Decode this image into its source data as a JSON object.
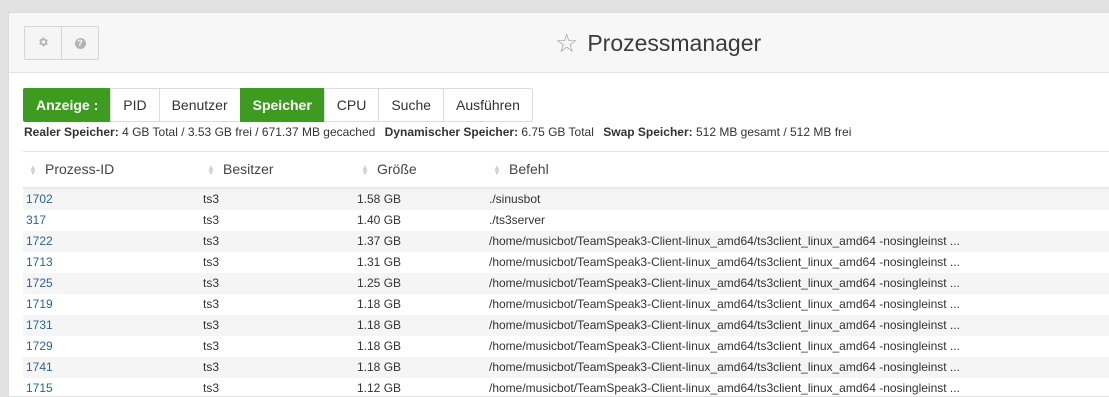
{
  "header": {
    "title": "Prozessmanager",
    "icons": [
      "gear-icon",
      "help-icon"
    ],
    "help_glyph": "?"
  },
  "tabs": [
    {
      "label": "Anzeige :",
      "active": true
    },
    {
      "label": "PID",
      "active": false
    },
    {
      "label": "Benutzer",
      "active": false
    },
    {
      "label": "Speicher",
      "active": true
    },
    {
      "label": "CPU",
      "active": false
    },
    {
      "label": "Suche",
      "active": false
    },
    {
      "label": "Ausführen",
      "active": false
    }
  ],
  "memory": {
    "real_label": "Realer Speicher:",
    "real_value": "4 GB Total / 3.53 GB frei / 671.37 MB gecached",
    "dynamic_label": "Dynamischer Speicher:",
    "dynamic_value": "6.75 GB Total",
    "swap_label": "Swap Speicher:",
    "swap_value": "512 MB gesamt / 512 MB frei"
  },
  "table": {
    "columns": [
      "Prozess-ID",
      "Besitzer",
      "Größe",
      "Befehl"
    ],
    "rows": [
      {
        "pid": "1702",
        "owner": "ts3",
        "size": "1.58 GB",
        "command": "./sinusbot"
      },
      {
        "pid": "317",
        "owner": "ts3",
        "size": "1.40 GB",
        "command": "./ts3server"
      },
      {
        "pid": "1722",
        "owner": "ts3",
        "size": "1.37 GB",
        "command": "/home/musicbot/TeamSpeak3-Client-linux_amd64/ts3client_linux_amd64 -nosingleinst ..."
      },
      {
        "pid": "1713",
        "owner": "ts3",
        "size": "1.31 GB",
        "command": "/home/musicbot/TeamSpeak3-Client-linux_amd64/ts3client_linux_amd64 -nosingleinst ..."
      },
      {
        "pid": "1725",
        "owner": "ts3",
        "size": "1.25 GB",
        "command": "/home/musicbot/TeamSpeak3-Client-linux_amd64/ts3client_linux_amd64 -nosingleinst ..."
      },
      {
        "pid": "1719",
        "owner": "ts3",
        "size": "1.18 GB",
        "command": "/home/musicbot/TeamSpeak3-Client-linux_amd64/ts3client_linux_amd64 -nosingleinst ..."
      },
      {
        "pid": "1731",
        "owner": "ts3",
        "size": "1.18 GB",
        "command": "/home/musicbot/TeamSpeak3-Client-linux_amd64/ts3client_linux_amd64 -nosingleinst ..."
      },
      {
        "pid": "1729",
        "owner": "ts3",
        "size": "1.18 GB",
        "command": "/home/musicbot/TeamSpeak3-Client-linux_amd64/ts3client_linux_amd64 -nosingleinst ..."
      },
      {
        "pid": "1741",
        "owner": "ts3",
        "size": "1.18 GB",
        "command": "/home/musicbot/TeamSpeak3-Client-linux_amd64/ts3client_linux_amd64 -nosingleinst ..."
      },
      {
        "pid": "1715",
        "owner": "ts3",
        "size": "1.12 GB",
        "command": "/home/musicbot/TeamSpeak3-Client-linux_amd64/ts3client_linux_amd64 -nosingleinst ..."
      }
    ]
  },
  "colors": {
    "accent_green": "#3d9c1f",
    "link_blue": "#2a6496",
    "background": "#e2e2e2"
  }
}
